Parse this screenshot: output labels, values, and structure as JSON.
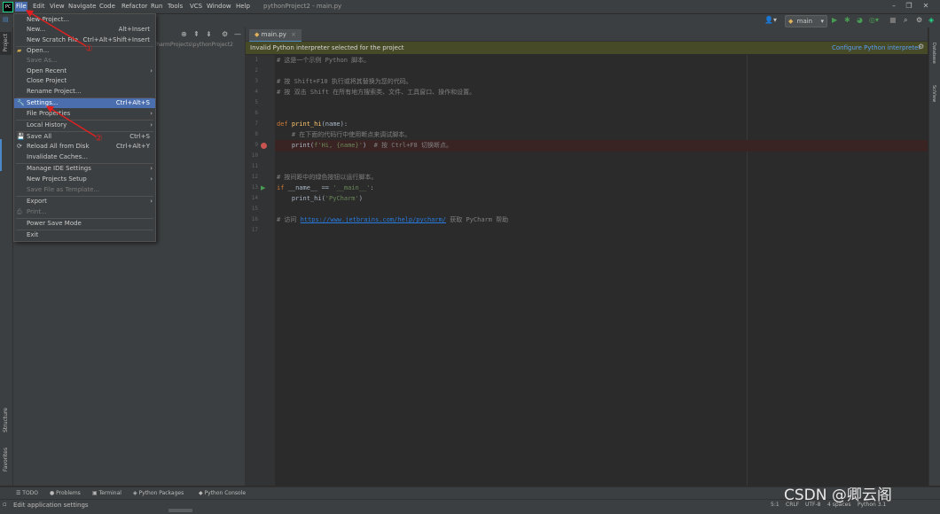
{
  "menubar": {
    "app_icon": "PC",
    "items": [
      "File",
      "Edit",
      "View",
      "Navigate",
      "Code",
      "Refactor",
      "Run",
      "Tools",
      "VCS",
      "Window",
      "Help"
    ],
    "window_title": "pythonProject2 - main.py"
  },
  "toolbar": {
    "run_config": "main",
    "icons": [
      "user-icon",
      "run-icon",
      "debug-icon",
      "coverage-icon",
      "profile-icon",
      "stop-icon",
      "search-icon",
      "settings-icon",
      "logo-icon"
    ]
  },
  "project_panel": {
    "tab_label": "Project",
    "path": "charmProjects\\pythonProject2"
  },
  "file_menu": {
    "items": [
      {
        "label": "New Project...",
        "shortcut": "",
        "arrow": false,
        "disabled": false
      },
      {
        "label": "New...",
        "shortcut": "Alt+Insert",
        "arrow": false,
        "disabled": false
      },
      {
        "label": "New Scratch File",
        "shortcut": "Ctrl+Alt+Shift+Insert",
        "arrow": false,
        "disabled": false
      },
      {
        "label": "Open...",
        "shortcut": "",
        "arrow": false,
        "disabled": false
      },
      {
        "label": "Save As...",
        "shortcut": "",
        "arrow": false,
        "disabled": true
      },
      {
        "label": "Open Recent",
        "shortcut": "",
        "arrow": true,
        "disabled": false
      },
      {
        "label": "Close Project",
        "shortcut": "",
        "arrow": false,
        "disabled": false
      },
      {
        "label": "Rename Project...",
        "shortcut": "",
        "arrow": false,
        "disabled": false
      },
      {
        "label": "Settings...",
        "shortcut": "Ctrl+Alt+S",
        "arrow": false,
        "disabled": false,
        "selected": true
      },
      {
        "label": "File Properties",
        "shortcut": "",
        "arrow": true,
        "disabled": false
      },
      {
        "label": "Local History",
        "shortcut": "",
        "arrow": true,
        "disabled": false
      },
      {
        "label": "Save All",
        "shortcut": "Ctrl+S",
        "arrow": false,
        "disabled": false
      },
      {
        "label": "Reload All from Disk",
        "shortcut": "Ctrl+Alt+Y",
        "arrow": false,
        "disabled": false
      },
      {
        "label": "Invalidate Caches...",
        "shortcut": "",
        "arrow": false,
        "disabled": false
      },
      {
        "label": "Manage IDE Settings",
        "shortcut": "",
        "arrow": true,
        "disabled": false
      },
      {
        "label": "New Projects Setup",
        "shortcut": "",
        "arrow": true,
        "disabled": false
      },
      {
        "label": "Save File as Template...",
        "shortcut": "",
        "arrow": false,
        "disabled": true
      },
      {
        "label": "Export",
        "shortcut": "",
        "arrow": true,
        "disabled": false
      },
      {
        "label": "Print...",
        "shortcut": "",
        "arrow": false,
        "disabled": true
      },
      {
        "label": "Power Save Mode",
        "shortcut": "",
        "arrow": false,
        "disabled": false
      },
      {
        "label": "Exit",
        "shortcut": "",
        "arrow": false,
        "disabled": false
      }
    ]
  },
  "editor": {
    "tab": "main.py",
    "banner_text": "Invalid Python interpreter selected for the project",
    "banner_link": "Configure Python interpreter",
    "line_numbers": [
      "1",
      "2",
      "3",
      "4",
      "5",
      "6",
      "7",
      "8",
      "9",
      "10",
      "11",
      "12",
      "13",
      "14",
      "15",
      "16",
      "17"
    ],
    "lines": {
      "l1": "# 这是一个示例 Python 脚本。",
      "l3": "# 按 Shift+F10 执行或将其替换为您的代码。",
      "l4": "# 按 双击 Shift 在所有地方搜索类、文件、工具窗口、操作和设置。",
      "l7_kw": "def ",
      "l7_fn": "print_hi",
      "l7_rest": "(name):",
      "l8": "    # 在下面的代码行中使用断点来调试脚本。",
      "l9_a": "    print(",
      "l9_b": "f'Hi, {name}'",
      "l9_c": ")  ",
      "l9_d": "# 按 Ctrl+F8 切换断点。",
      "l12": "# 按间距中的绿色按钮以运行脚本。",
      "l13_kw": "if ",
      "l13_a": "__name__ == ",
      "l13_b": "'__main__'",
      "l13_c": ":",
      "l14_a": "    print_hi(",
      "l14_b": "'PyCharm'",
      "l14_c": ")",
      "l16_a": "# 访问 ",
      "l16_url": "https://www.jetbrains.com/help/pycharm/",
      "l16_b": " 获取 PyCharm 帮助"
    }
  },
  "right_stripe": {
    "database": "Database",
    "scview": "SciView"
  },
  "left_stripe": {
    "structure": "Structure",
    "favorites": "Favorites"
  },
  "bottom_tabs": [
    "TODO",
    "Problems",
    "Terminal",
    "Python Packages",
    "Python Console"
  ],
  "status": {
    "message": "Edit application settings",
    "position": "5:1",
    "line_sep": "CRLF",
    "encoding": "UTF-8",
    "indent": "4 spaces",
    "interpreter": "Python 3.1"
  },
  "annotations": {
    "marker1": "①",
    "marker2": "②"
  },
  "watermark": "CSDN @卿云阁"
}
